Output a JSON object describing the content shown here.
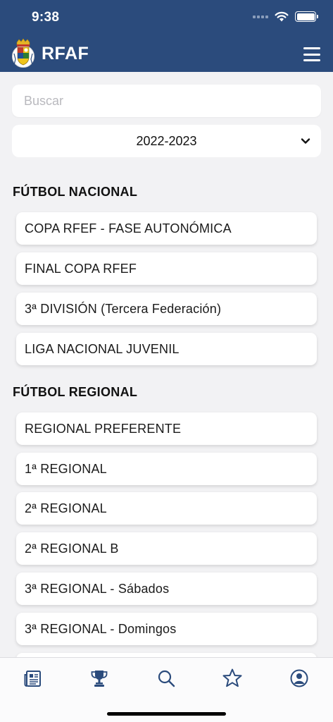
{
  "status_bar": {
    "time": "9:38"
  },
  "header": {
    "title": "RFAF"
  },
  "search": {
    "placeholder": "Buscar",
    "value": ""
  },
  "season_select": {
    "selected": "2022-2023"
  },
  "sections": [
    {
      "title": "FÚTBOL NACIONAL",
      "items": [
        "COPA RFEF - FASE AUTONÓMICA",
        "FINAL COPA RFEF",
        "3ª DIVISIÓN (Tercera Federación)",
        "LIGA NACIONAL JUVENIL"
      ]
    },
    {
      "title": "FÚTBOL REGIONAL",
      "items": [
        "REGIONAL PREFERENTE",
        "1ª REGIONAL",
        "2ª REGIONAL",
        "2ª REGIONAL B",
        "3ª REGIONAL - Sábados",
        "3ª REGIONAL - Domingos",
        ""
      ]
    }
  ],
  "tab_bar": [
    {
      "icon": "news-icon"
    },
    {
      "icon": "trophy-icon"
    },
    {
      "icon": "search-icon"
    },
    {
      "icon": "star-icon"
    },
    {
      "icon": "profile-icon"
    }
  ],
  "colors": {
    "primary": "#2b4b7c",
    "background": "#f2f2f4",
    "card": "#ffffff"
  }
}
